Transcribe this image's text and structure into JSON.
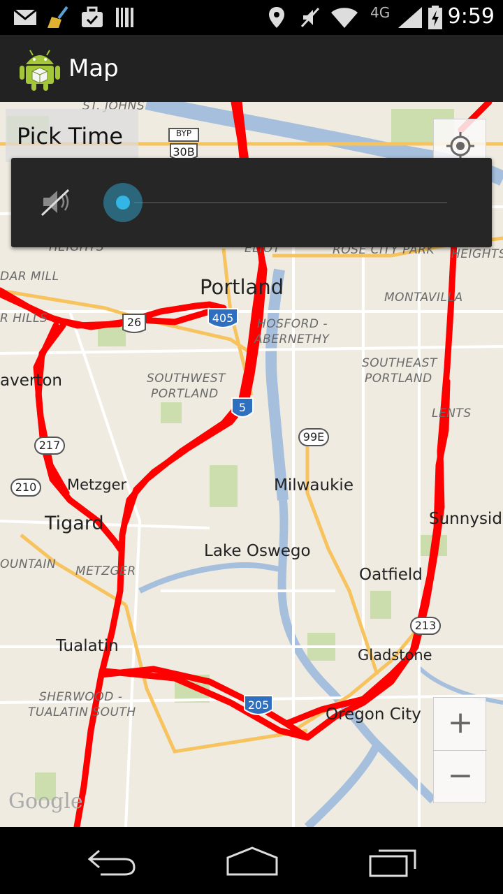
{
  "status_bar": {
    "time": "9:59",
    "network_type": "4G",
    "left_icons": [
      "gmail-icon",
      "broom-icon",
      "briefcase-icon",
      "barcode-icon"
    ],
    "right_icons": [
      "location-icon",
      "mute-icon",
      "wifi-icon",
      "signal-icon",
      "battery-charging-icon"
    ]
  },
  "action_bar": {
    "title": "Map",
    "icon": "android-app-icon"
  },
  "map": {
    "pick_time_label": "Pick Time",
    "provider": "Google",
    "zoom_in_label": "+",
    "zoom_out_label": "−",
    "colors": {
      "route": "#ff0000",
      "water": "#a5bfdd",
      "park": "#c5dba4",
      "highway": "#f6c35e",
      "land": "#efebe1"
    },
    "place_labels": {
      "portland": "Portland",
      "milwaukie": "Milwaukie",
      "lake_oswego": "Lake Oswego",
      "oatfield": "Oatfield",
      "gladstone": "Gladstone",
      "oregon_city": "Oregon City",
      "tigard": "Tigard",
      "metzger": "Metzger",
      "tualatin": "Tualatin",
      "beaverton": "averton",
      "sunnyside": "Sunnyside"
    },
    "district_labels": {
      "st_johns": "ST. JOHNS",
      "southwest_portland_1": "SOUTHWEST",
      "southwest_portland_2": "PORTLAND",
      "southeast_portland_1": "SOUTHEAST",
      "southeast_portland_2": "PORTLAND",
      "hosford_1": "HOSFORD -",
      "hosford_2": "ABERNETHY",
      "montavilla": "MONTAVILLA",
      "rose_city_park": "ROSE CITY PARK",
      "metzger_district": "METZGER",
      "sherwood_1": "SHERWOOD -",
      "sherwood_2": "TUALATIN SOUTH",
      "cedar_mill": "DAR MILL",
      "cedar_hills": "R HILLS",
      "heights_left": "HEIGHTS",
      "heights_right": "HEIGHTS",
      "lents": "LENTS",
      "mountain": "OUNTAIN",
      "eliot": "ELIOT"
    },
    "shields": {
      "i405": "405",
      "i5": "5",
      "i205": "205",
      "us26": "26",
      "or217": "217",
      "or210": "210",
      "or99e": "99E",
      "or213": "213",
      "byp": "BYP",
      "us30b": "30B"
    }
  },
  "volume_panel": {
    "icon": "speaker-muted-icon",
    "level": 0
  },
  "nav_bar": {
    "back": "back-icon",
    "home": "home-icon",
    "recents": "recents-icon"
  }
}
